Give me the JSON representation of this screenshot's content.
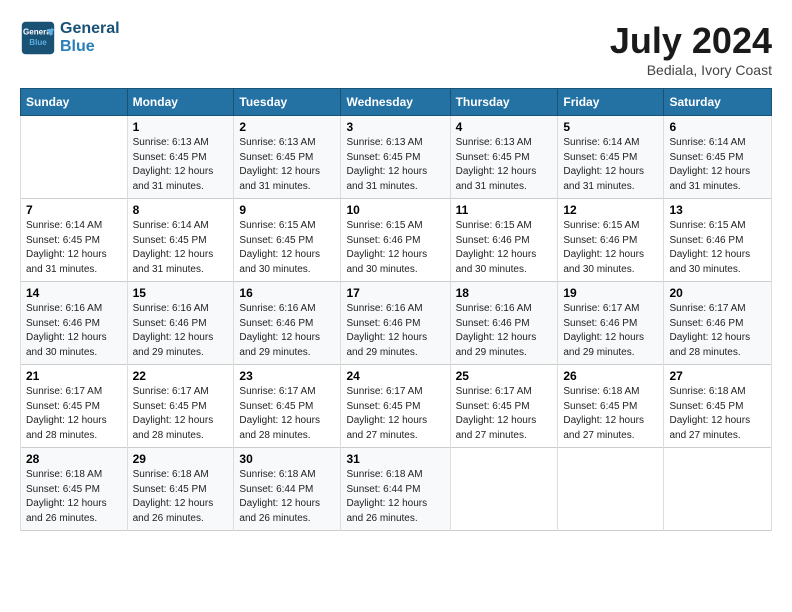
{
  "header": {
    "logo_line1": "General",
    "logo_line2": "Blue",
    "month_year": "July 2024",
    "location": "Bediala, Ivory Coast"
  },
  "days_of_week": [
    "Sunday",
    "Monday",
    "Tuesday",
    "Wednesday",
    "Thursday",
    "Friday",
    "Saturday"
  ],
  "weeks": [
    [
      {
        "day": "",
        "info": ""
      },
      {
        "day": "1",
        "info": "Sunrise: 6:13 AM\nSunset: 6:45 PM\nDaylight: 12 hours\nand 31 minutes."
      },
      {
        "day": "2",
        "info": "Sunrise: 6:13 AM\nSunset: 6:45 PM\nDaylight: 12 hours\nand 31 minutes."
      },
      {
        "day": "3",
        "info": "Sunrise: 6:13 AM\nSunset: 6:45 PM\nDaylight: 12 hours\nand 31 minutes."
      },
      {
        "day": "4",
        "info": "Sunrise: 6:13 AM\nSunset: 6:45 PM\nDaylight: 12 hours\nand 31 minutes."
      },
      {
        "day": "5",
        "info": "Sunrise: 6:14 AM\nSunset: 6:45 PM\nDaylight: 12 hours\nand 31 minutes."
      },
      {
        "day": "6",
        "info": "Sunrise: 6:14 AM\nSunset: 6:45 PM\nDaylight: 12 hours\nand 31 minutes."
      }
    ],
    [
      {
        "day": "7",
        "info": "Sunrise: 6:14 AM\nSunset: 6:45 PM\nDaylight: 12 hours\nand 31 minutes."
      },
      {
        "day": "8",
        "info": "Sunrise: 6:14 AM\nSunset: 6:45 PM\nDaylight: 12 hours\nand 31 minutes."
      },
      {
        "day": "9",
        "info": "Sunrise: 6:15 AM\nSunset: 6:45 PM\nDaylight: 12 hours\nand 30 minutes."
      },
      {
        "day": "10",
        "info": "Sunrise: 6:15 AM\nSunset: 6:46 PM\nDaylight: 12 hours\nand 30 minutes."
      },
      {
        "day": "11",
        "info": "Sunrise: 6:15 AM\nSunset: 6:46 PM\nDaylight: 12 hours\nand 30 minutes."
      },
      {
        "day": "12",
        "info": "Sunrise: 6:15 AM\nSunset: 6:46 PM\nDaylight: 12 hours\nand 30 minutes."
      },
      {
        "day": "13",
        "info": "Sunrise: 6:15 AM\nSunset: 6:46 PM\nDaylight: 12 hours\nand 30 minutes."
      }
    ],
    [
      {
        "day": "14",
        "info": "Sunrise: 6:16 AM\nSunset: 6:46 PM\nDaylight: 12 hours\nand 30 minutes."
      },
      {
        "day": "15",
        "info": "Sunrise: 6:16 AM\nSunset: 6:46 PM\nDaylight: 12 hours\nand 29 minutes."
      },
      {
        "day": "16",
        "info": "Sunrise: 6:16 AM\nSunset: 6:46 PM\nDaylight: 12 hours\nand 29 minutes."
      },
      {
        "day": "17",
        "info": "Sunrise: 6:16 AM\nSunset: 6:46 PM\nDaylight: 12 hours\nand 29 minutes."
      },
      {
        "day": "18",
        "info": "Sunrise: 6:16 AM\nSunset: 6:46 PM\nDaylight: 12 hours\nand 29 minutes."
      },
      {
        "day": "19",
        "info": "Sunrise: 6:17 AM\nSunset: 6:46 PM\nDaylight: 12 hours\nand 29 minutes."
      },
      {
        "day": "20",
        "info": "Sunrise: 6:17 AM\nSunset: 6:46 PM\nDaylight: 12 hours\nand 28 minutes."
      }
    ],
    [
      {
        "day": "21",
        "info": "Sunrise: 6:17 AM\nSunset: 6:45 PM\nDaylight: 12 hours\nand 28 minutes."
      },
      {
        "day": "22",
        "info": "Sunrise: 6:17 AM\nSunset: 6:45 PM\nDaylight: 12 hours\nand 28 minutes."
      },
      {
        "day": "23",
        "info": "Sunrise: 6:17 AM\nSunset: 6:45 PM\nDaylight: 12 hours\nand 28 minutes."
      },
      {
        "day": "24",
        "info": "Sunrise: 6:17 AM\nSunset: 6:45 PM\nDaylight: 12 hours\nand 27 minutes."
      },
      {
        "day": "25",
        "info": "Sunrise: 6:17 AM\nSunset: 6:45 PM\nDaylight: 12 hours\nand 27 minutes."
      },
      {
        "day": "26",
        "info": "Sunrise: 6:18 AM\nSunset: 6:45 PM\nDaylight: 12 hours\nand 27 minutes."
      },
      {
        "day": "27",
        "info": "Sunrise: 6:18 AM\nSunset: 6:45 PM\nDaylight: 12 hours\nand 27 minutes."
      }
    ],
    [
      {
        "day": "28",
        "info": "Sunrise: 6:18 AM\nSunset: 6:45 PM\nDaylight: 12 hours\nand 26 minutes."
      },
      {
        "day": "29",
        "info": "Sunrise: 6:18 AM\nSunset: 6:45 PM\nDaylight: 12 hours\nand 26 minutes."
      },
      {
        "day": "30",
        "info": "Sunrise: 6:18 AM\nSunset: 6:44 PM\nDaylight: 12 hours\nand 26 minutes."
      },
      {
        "day": "31",
        "info": "Sunrise: 6:18 AM\nSunset: 6:44 PM\nDaylight: 12 hours\nand 26 minutes."
      },
      {
        "day": "",
        "info": ""
      },
      {
        "day": "",
        "info": ""
      },
      {
        "day": "",
        "info": ""
      }
    ]
  ]
}
